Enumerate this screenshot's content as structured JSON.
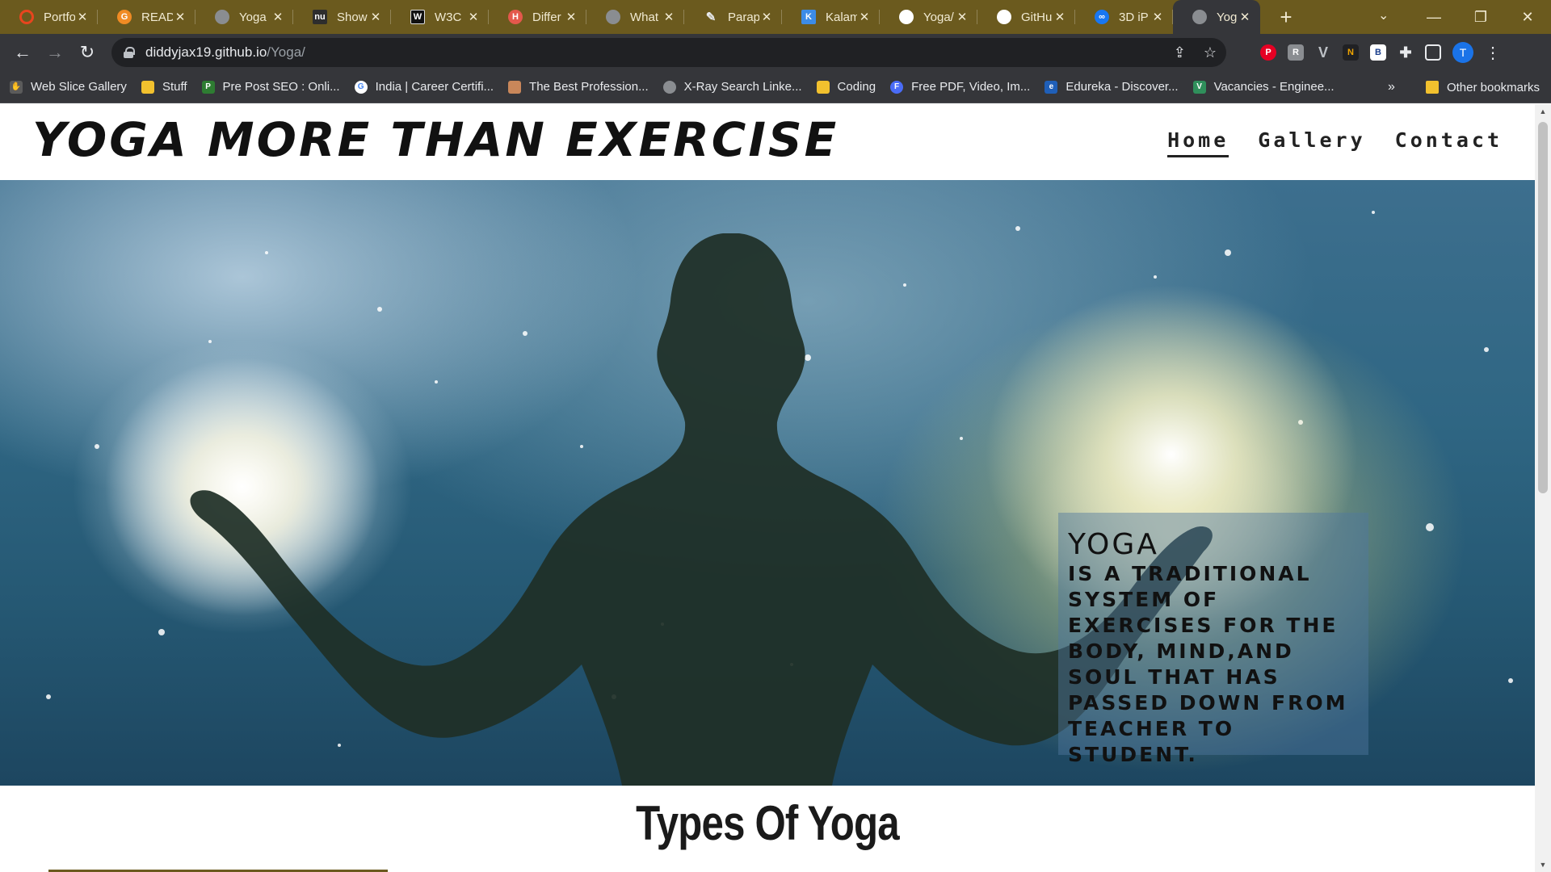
{
  "browser": {
    "tabs": [
      {
        "label": "Portfo",
        "icon": "opera-icon",
        "color": "#e8451e"
      },
      {
        "label": "READ",
        "icon": "gitbook-icon",
        "color": "#f08b24"
      },
      {
        "label": "Yoga",
        "icon": "globe-icon",
        "color": "#8a8d91"
      },
      {
        "label": "Show",
        "icon": "nu-icon",
        "color": "#2d2d2d"
      },
      {
        "label": "W3C",
        "icon": "w3c-icon",
        "color": "#111111"
      },
      {
        "label": "Differ",
        "icon": "hashnode-icon",
        "color": "#e4584c"
      },
      {
        "label": "What",
        "icon": "openai-icon",
        "color": "#8a8d91"
      },
      {
        "label": "Parap",
        "icon": "quill-icon",
        "color": "#5a5a5a"
      },
      {
        "label": "Kalam",
        "icon": "google-fonts-icon",
        "color": "#3c8ce7"
      },
      {
        "label": "Yoga/",
        "icon": "github-icon",
        "color": "#ffffff"
      },
      {
        "label": "GitHu",
        "icon": "github-icon",
        "color": "#ffffff"
      },
      {
        "label": "3D iP",
        "icon": "meta-icon",
        "color": "#1877f2"
      },
      {
        "label": "Yoga",
        "icon": "globe-icon",
        "color": "#8a8d91",
        "active": true
      }
    ],
    "new_tab": "+",
    "url_host": "diddyjax19.github.io",
    "url_path": "/Yoga/",
    "profile_initial": "T",
    "bookmarks": [
      {
        "label": "Web Slice Gallery",
        "icon": "web-slice-icon"
      },
      {
        "label": "Stuff",
        "icon": "folder-icon"
      },
      {
        "label": "Pre Post SEO : Onli...",
        "icon": "prepostseo-icon"
      },
      {
        "label": "India | Career Certifi...",
        "icon": "google-icon"
      },
      {
        "label": "The Best Profession...",
        "icon": "profession-icon"
      },
      {
        "label": "X-Ray Search Linke...",
        "icon": "globe-icon"
      },
      {
        "label": "Coding",
        "icon": "folder-icon"
      },
      {
        "label": "Free PDF, Video, Im...",
        "icon": "pdf-icon"
      },
      {
        "label": "Edureka - Discover...",
        "icon": "edureka-icon"
      },
      {
        "label": "Vacancies - Enginee...",
        "icon": "vacancies-icon"
      }
    ],
    "bookmarks_overflow": "»",
    "other_bookmarks": "Other bookmarks"
  },
  "site": {
    "logo": "YOGA MORE THAN EXERCISE",
    "nav": [
      {
        "label": "Home",
        "current": true
      },
      {
        "label": "Gallery",
        "current": false
      },
      {
        "label": "Contact",
        "current": false
      }
    ],
    "hero_caption": {
      "heading": "YOGA",
      "body": "IS A TRADITIONAL SYSTEM OF EXERCISES FOR THE BODY, MIND,AND SOUL THAT HAS PASSED DOWN FROM TEACHER TO STUDENT."
    },
    "section_title": "Types Of Yoga"
  }
}
